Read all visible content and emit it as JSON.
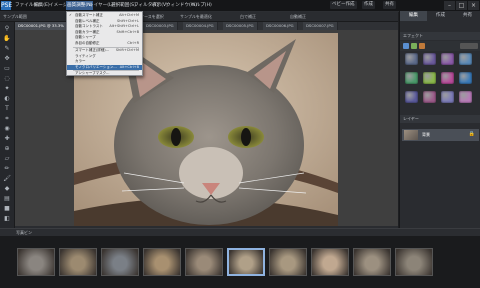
{
  "menubar": {
    "logo": "PSE",
    "items": [
      "ファイル(F)",
      "編集(E)",
      "イメージ(I)",
      "画質調整(N)",
      "レイヤー(L)",
      "選択範囲(S)",
      "フィルタ(T)",
      "表示(V)",
      "ウィンドウ(W)",
      "ヘルプ(H)"
    ],
    "right_buttons": [
      "ベビー作成",
      "作成",
      "共有"
    ],
    "window_controls": [
      "–",
      "□",
      "×"
    ]
  },
  "options_bar": {
    "items": [
      "サンプル範囲",
      "ソースを選択",
      "サンプルを最適化",
      "白で補正",
      "自動補正"
    ]
  },
  "doc_tabs": [
    "DSC00001.JPG @ 33.3%",
    "DSC00002.JPG",
    "DSC00003.JPG",
    "DSC00004.JPG",
    "DSC00005.JPG",
    "DSC00006.JPG",
    "DSC00007.JPG"
  ],
  "dropdown": {
    "items": [
      {
        "label": "自動スマート補正",
        "shortcut": "Alt+Ctrl+M",
        "check": "✓"
      },
      {
        "label": "自動レベル補正",
        "shortcut": "Shift+Ctrl+L",
        "check": ""
      },
      {
        "label": "自動コントラスト",
        "shortcut": "Alt+Shift+Ctrl+L",
        "check": ""
      },
      {
        "label": "自動カラー補正",
        "shortcut": "Shift+Ctrl+B",
        "check": ""
      },
      {
        "label": "自動シャープ",
        "shortcut": "",
        "check": ""
      },
      {
        "label": "赤目の自動修正",
        "shortcut": "Ctrl+R",
        "check": ""
      },
      {
        "label": "スマート補正(詳細)...",
        "shortcut": "Shift+Ctrl+M",
        "check": ""
      },
      {
        "label": "ライティング",
        "shortcut": "",
        "check": ""
      },
      {
        "label": "カラー",
        "shortcut": "",
        "check": ""
      },
      {
        "label": "モノクロバリエーション...",
        "shortcut": "Alt+Ctrl+B",
        "check": ""
      },
      {
        "label": "アンシャープマスク...",
        "shortcut": "",
        "check": ""
      },
      {
        "label": "シャープ(詳細)...",
        "shortcut": "",
        "check": ""
      }
    ]
  },
  "panel": {
    "tabs": [
      "編集",
      "作成",
      "共有"
    ],
    "effects_title": "エフェクト",
    "layers_title": "レイヤー",
    "layer_name": "背景",
    "swatch_colors": [
      "#5c6a8a",
      "#6a5a9c",
      "#8a5aa8",
      "#5a8ab8",
      "#4a9a6a",
      "#8ab84a",
      "#b84a9a",
      "#3a7ab8",
      "#5a5a9c",
      "#9c5a8a",
      "#7a7ab8",
      "#b87ab8"
    ]
  },
  "bin": {
    "label": "写真ビン",
    "count": 10,
    "selected_index": 5
  }
}
